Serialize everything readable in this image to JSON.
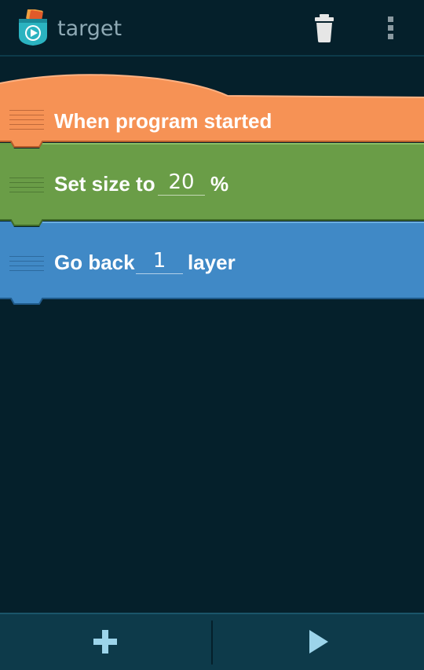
{
  "actionbar": {
    "title": "target",
    "icons": [
      "pocket-code-app-icon",
      "trash-icon",
      "overflow-menu-icon"
    ]
  },
  "bricks": [
    {
      "type": "event",
      "label": "When program started",
      "color": "#f69255"
    },
    {
      "type": "look",
      "label_before": "Set size to",
      "value": "20",
      "label_after": "%",
      "color": "#6a9d47"
    },
    {
      "type": "look",
      "label_before": "Go back",
      "value": "1",
      "label_after": "layer",
      "color": "#4089c6"
    }
  ],
  "bottombar": {
    "icons": [
      "add-icon",
      "play-icon"
    ]
  },
  "colors": {
    "background": "#05202b",
    "bar": "#0d3a4a",
    "accent_icon": "#9cd4ea",
    "title": "#8ea9b4"
  }
}
